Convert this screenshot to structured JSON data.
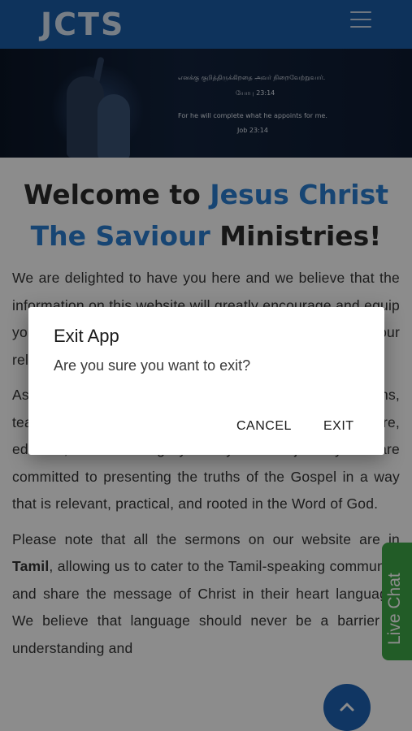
{
  "header": {
    "logo": "JCTS",
    "menu_icon": "hamburger-menu-icon",
    "background_color": "#1b5ea8"
  },
  "banner": {
    "tamil_line": "எனக்கு குறித்திருக்கிறதை அவர் நிறைவேற்றுவார்.",
    "tamil_ref": "யோபு 23:14",
    "english_line": "For he will complete what he appoints for me.",
    "english_ref": "Job 23:14"
  },
  "main": {
    "title_part1": "Welcome to ",
    "title_highlight": "Jesus Christ The Saviour",
    "title_part2": " Ministries!",
    "para1": "We are delighted to have you here and we believe that the information on this website will greatly encourage and equip you to grow in your faith and help you grow in your relationship with Jesus Christ and to know Him more.",
    "para2": "As a ministry, we offer a wide collection of sermons, teachings, and resources that are designed to inspire, educate, and encourage you in your faith journey. We are committed to presenting the truths of the Gospel in a way that is relevant, practical, and rooted in the Word of God.",
    "para3_pre": "Please note that all the sermons on our website are in ",
    "para3_bold": "Tamil",
    "para3_post": ", allowing us to cater to the Tamil-speaking community and share the message of Christ in their heart language. We believe that language should never be a barrier in understanding and"
  },
  "live_chat": {
    "label": "Live Chat",
    "color": "#3fa847"
  },
  "scroll_top": {
    "icon": "chevron-up-icon"
  },
  "dialog": {
    "title": "Exit App",
    "message": "Are you sure you want to exit?",
    "cancel_label": "CANCEL",
    "exit_label": "EXIT"
  }
}
